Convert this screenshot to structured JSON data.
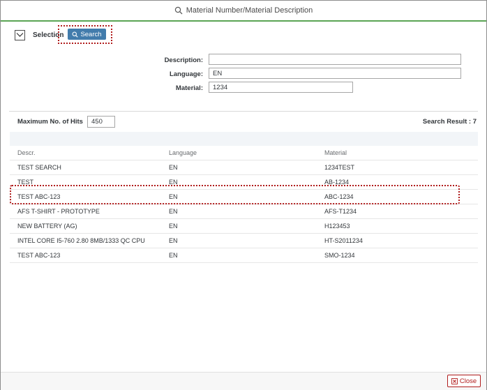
{
  "dialog": {
    "title": "Material Number/Material Description"
  },
  "selection": {
    "label": "Selection",
    "search_label": "Search"
  },
  "form": {
    "description": {
      "label": "Description:",
      "value": ""
    },
    "language": {
      "label": "Language:",
      "value": "EN"
    },
    "material": {
      "label": "Material:",
      "value": "1234"
    }
  },
  "results": {
    "max_hits_label": "Maximum No. of Hits",
    "max_hits_value": "450",
    "result_text": "Search Result : 7",
    "columns": [
      "Descr.",
      "Language",
      "Material"
    ],
    "rows": [
      [
        "TEST SEARCH",
        "EN",
        "1234TEST"
      ],
      [
        "TEST",
        "EN",
        "AB-1234"
      ],
      [
        "TEST ABC-123",
        "EN",
        "ABC-1234"
      ],
      [
        "AFS T-SHIRT - PROTOTYPE",
        "EN",
        "AFS-T1234"
      ],
      [
        "NEW BATTERY (AG)",
        "EN",
        "H123453"
      ],
      [
        "INTEL CORE I5-760 2.80 8MB/1333 QC CPU",
        "EN",
        "HT-S2011234"
      ],
      [
        "TEST ABC-123",
        "EN",
        "SMO-1234"
      ]
    ]
  },
  "footer": {
    "close_label": "Close"
  },
  "colors": {
    "accent": "#427cac",
    "highlight": "#b01c1c",
    "title_underline": "#5aa454"
  }
}
